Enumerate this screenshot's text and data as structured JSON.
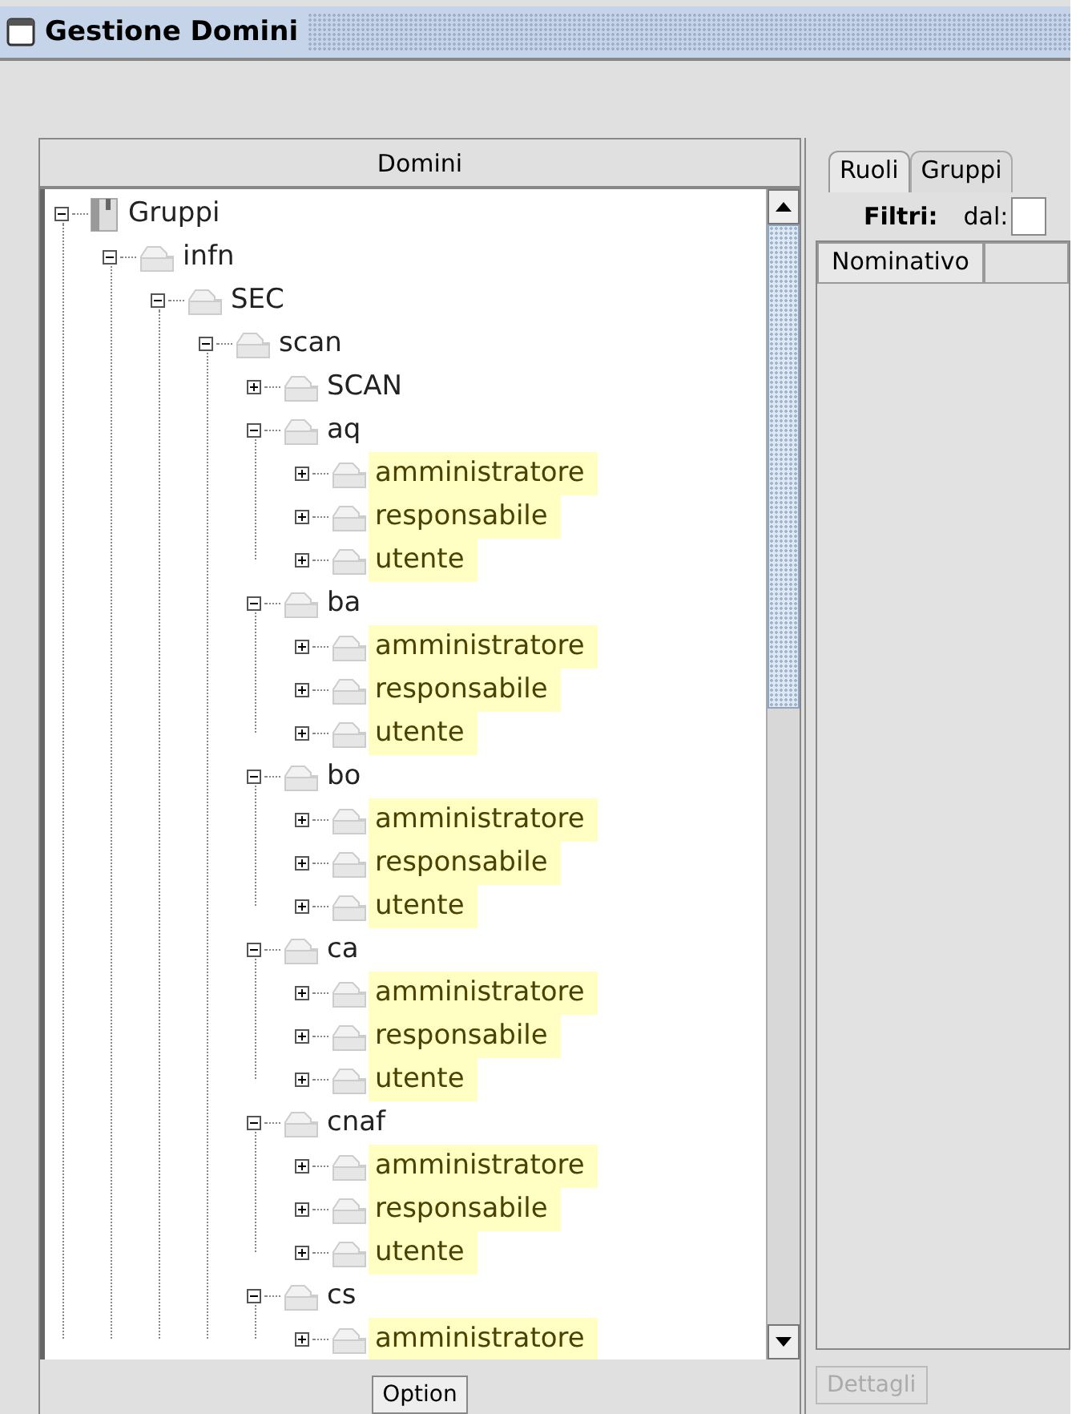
{
  "window": {
    "title": "Gestione Domini"
  },
  "left_panel": {
    "title": "Domini",
    "tree": [
      {
        "label": "Gruppi",
        "expanded": true,
        "highlighted": false,
        "children": [
          {
            "label": "infn",
            "expanded": true,
            "highlighted": false,
            "children": [
              {
                "label": "SEC",
                "expanded": true,
                "highlighted": false,
                "children": [
                  {
                    "label": "scan",
                    "expanded": true,
                    "highlighted": false,
                    "children": [
                      {
                        "label": "SCAN",
                        "expanded": false,
                        "highlighted": false
                      },
                      {
                        "label": "aq",
                        "expanded": true,
                        "highlighted": false,
                        "children": [
                          {
                            "label": "amministratore",
                            "expanded": false,
                            "highlighted": true
                          },
                          {
                            "label": "responsabile",
                            "expanded": false,
                            "highlighted": true
                          },
                          {
                            "label": "utente",
                            "expanded": false,
                            "highlighted": true
                          }
                        ]
                      },
                      {
                        "label": "ba",
                        "expanded": true,
                        "highlighted": false,
                        "children": [
                          {
                            "label": "amministratore",
                            "expanded": false,
                            "highlighted": true
                          },
                          {
                            "label": "responsabile",
                            "expanded": false,
                            "highlighted": true
                          },
                          {
                            "label": "utente",
                            "expanded": false,
                            "highlighted": true
                          }
                        ]
                      },
                      {
                        "label": "bo",
                        "expanded": true,
                        "highlighted": false,
                        "children": [
                          {
                            "label": "amministratore",
                            "expanded": false,
                            "highlighted": true
                          },
                          {
                            "label": "responsabile",
                            "expanded": false,
                            "highlighted": true
                          },
                          {
                            "label": "utente",
                            "expanded": false,
                            "highlighted": true
                          }
                        ]
                      },
                      {
                        "label": "ca",
                        "expanded": true,
                        "highlighted": false,
                        "children": [
                          {
                            "label": "amministratore",
                            "expanded": false,
                            "highlighted": true
                          },
                          {
                            "label": "responsabile",
                            "expanded": false,
                            "highlighted": true
                          },
                          {
                            "label": "utente",
                            "expanded": false,
                            "highlighted": true
                          }
                        ]
                      },
                      {
                        "label": "cnaf",
                        "expanded": true,
                        "highlighted": false,
                        "children": [
                          {
                            "label": "amministratore",
                            "expanded": false,
                            "highlighted": true
                          },
                          {
                            "label": "responsabile",
                            "expanded": false,
                            "highlighted": true
                          },
                          {
                            "label": "utente",
                            "expanded": false,
                            "highlighted": true
                          }
                        ]
                      },
                      {
                        "label": "cs",
                        "expanded": true,
                        "highlighted": false,
                        "children": [
                          {
                            "label": "amministratore",
                            "expanded": false,
                            "highlighted": true
                          }
                        ]
                      }
                    ]
                  }
                ]
              }
            ]
          }
        ]
      }
    ],
    "button": "Option"
  },
  "right_panel": {
    "tabs": [
      {
        "label": "Ruoli",
        "selected": true
      },
      {
        "label": "Gruppi",
        "selected": false
      }
    ],
    "filter_label": "Filtri:",
    "date_label": "dal:",
    "table": {
      "columns": [
        "Nominativo"
      ]
    },
    "button": {
      "label": "Dettagli",
      "disabled": true
    }
  }
}
